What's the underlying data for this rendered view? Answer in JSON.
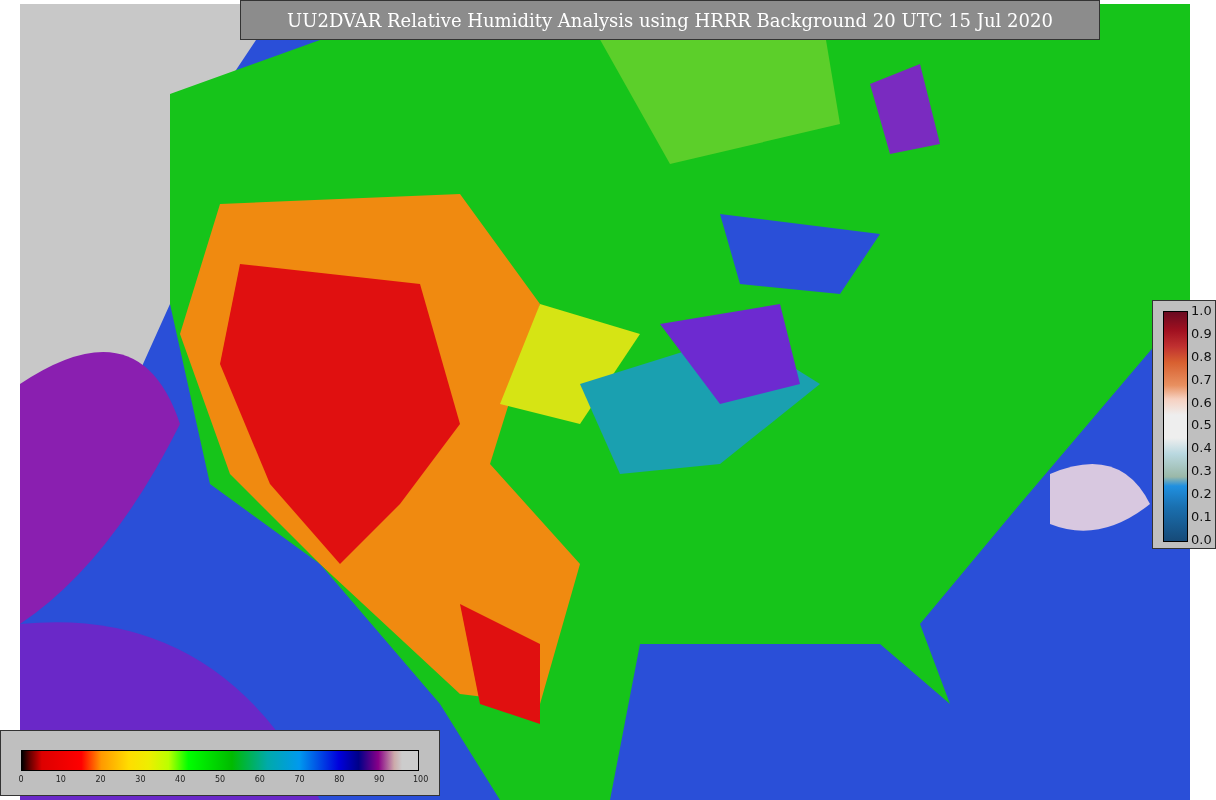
{
  "title": "UU2DVAR Relative Humidity Analysis using HRRR Background 20 UTC 15 Jul 2020",
  "horizontal_colorbar": {
    "labels": [
      "0",
      "10",
      "20",
      "30",
      "40",
      "50",
      "60",
      "70",
      "80",
      "90",
      "100"
    ]
  },
  "vertical_colorbar": {
    "labels": [
      "1.0",
      "0.9",
      "0.8",
      "0.7",
      "0.6",
      "0.5",
      "0.4",
      "0.3",
      "0.2",
      "0.1",
      "0.0"
    ]
  }
}
